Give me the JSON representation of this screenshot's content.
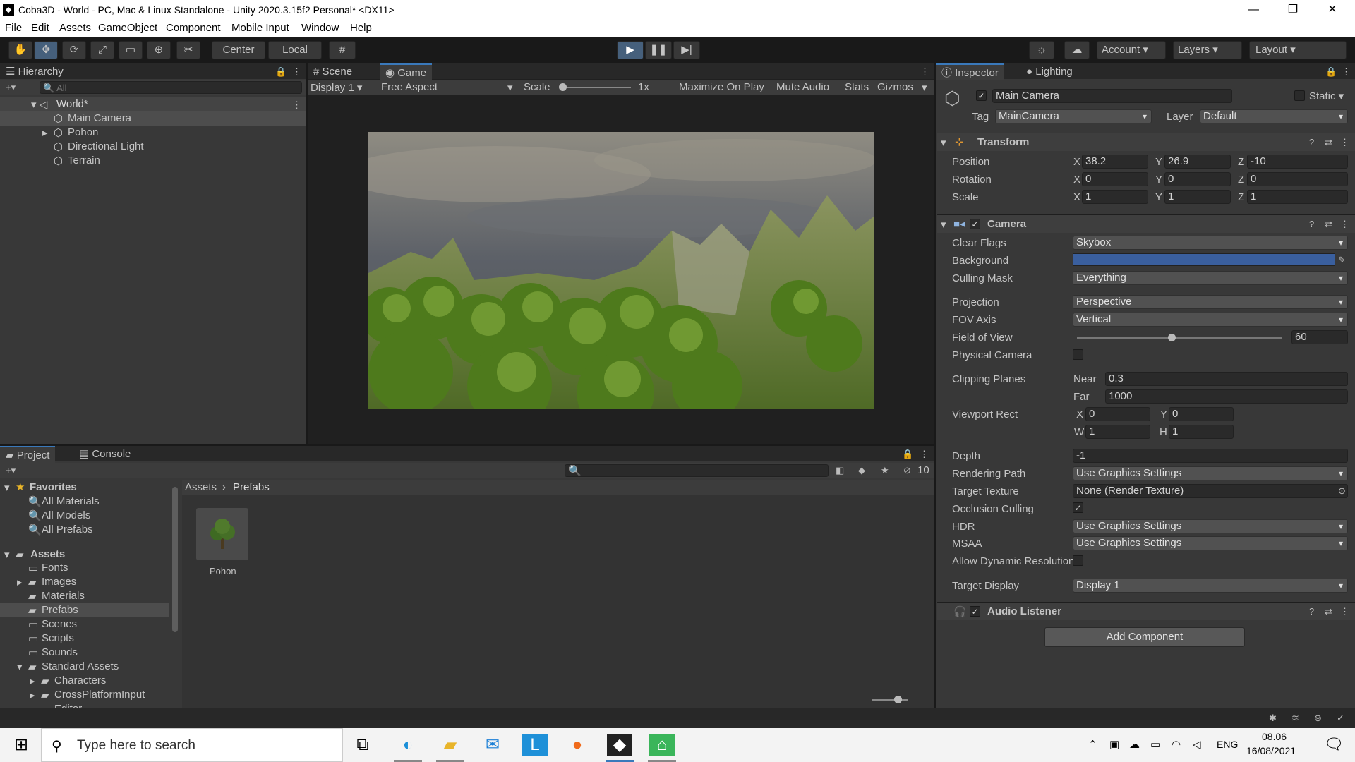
{
  "window": {
    "title": "Coba3D - World - PC, Mac & Linux Standalone - Unity 2020.3.15f2 Personal* <DX11>",
    "minimize": "—",
    "maximize": "❐",
    "close": "✕"
  },
  "menu": [
    "File",
    "Edit",
    "Assets",
    "GameObject",
    "Component",
    "Mobile Input",
    "Window",
    "Help"
  ],
  "toolbar": {
    "center": "Center",
    "local": "Local",
    "account": "Account",
    "layers": "Layers",
    "layout": "Layout"
  },
  "hierarchy": {
    "tab": "Hierarchy",
    "search_placeholder": "All",
    "scene": "World*",
    "items": [
      "Main Camera",
      "Pohon",
      "Directional Light",
      "Terrain"
    ]
  },
  "game": {
    "tab_scene": "Scene",
    "tab_game": "Game",
    "display": "Display 1",
    "aspect": "Free Aspect",
    "scale_label": "Scale",
    "scale_value": "1x",
    "maximize": "Maximize On Play",
    "mute": "Mute Audio",
    "stats": "Stats",
    "gizmos": "Gizmos"
  },
  "project": {
    "tab_project": "Project",
    "tab_console": "Console",
    "hidden_count": "10",
    "favorites": "Favorites",
    "fav_items": [
      "All Materials",
      "All Models",
      "All Prefabs"
    ],
    "assets": "Assets",
    "asset_folders": [
      "Fonts",
      "Images",
      "Materials",
      "Prefabs",
      "Scenes",
      "Scripts",
      "Sounds",
      "Standard Assets",
      "Characters",
      "CrossPlatformInput",
      "Editor"
    ],
    "breadcrumb_root": "Assets",
    "breadcrumb_current": "Prefabs",
    "asset_name": "Pohon"
  },
  "inspector": {
    "tab": "Inspector",
    "lighting_tab": "Lighting",
    "object_name": "Main Camera",
    "static": "Static",
    "tag_label": "Tag",
    "tag": "MainCamera",
    "layer_label": "Layer",
    "layer": "Default",
    "transform": {
      "title": "Transform",
      "position_label": "Position",
      "rotation_label": "Rotation",
      "scale_label": "Scale",
      "position": [
        "38.2",
        "26.9",
        "-10"
      ],
      "rotation": [
        "0",
        "0",
        "0"
      ],
      "scale": [
        "1",
        "1",
        "1"
      ]
    },
    "camera": {
      "title": "Camera",
      "clear_flags_label": "Clear Flags",
      "clear_flags": "Skybox",
      "background_label": "Background",
      "background_color": "#3a5f9e",
      "culling_mask_label": "Culling Mask",
      "culling_mask": "Everything",
      "projection_label": "Projection",
      "projection": "Perspective",
      "fov_axis_label": "FOV Axis",
      "fov_axis": "Vertical",
      "fov_label": "Field of View",
      "fov": "60",
      "physical_label": "Physical Camera",
      "clipping_label": "Clipping Planes",
      "near_label": "Near",
      "near": "0.3",
      "far_label": "Far",
      "far": "1000",
      "viewport_label": "Viewport Rect",
      "vp_x": "0",
      "vp_y": "0",
      "vp_w": "1",
      "vp_h": "1",
      "depth_label": "Depth",
      "depth": "-1",
      "rendering_path_label": "Rendering Path",
      "rendering_path": "Use Graphics Settings",
      "target_texture_label": "Target Texture",
      "target_texture": "None (Render Texture)",
      "occlusion_label": "Occlusion Culling",
      "hdr_label": "HDR",
      "hdr": "Use Graphics Settings",
      "msaa_label": "MSAA",
      "msaa": "Use Graphics Settings",
      "dynres_label": "Allow Dynamic Resolution",
      "target_display_label": "Target Display",
      "target_display": "Display 1"
    },
    "audio_listener": "Audio Listener",
    "add_component": "Add Component"
  },
  "taskbar": {
    "search_placeholder": "Type here to search",
    "lang": "ENG",
    "time": "08.06",
    "date": "16/08/2021"
  }
}
